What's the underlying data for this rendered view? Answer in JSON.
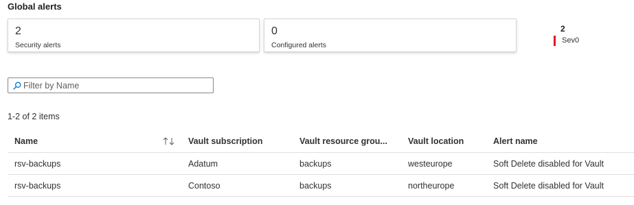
{
  "section_title": "Global alerts",
  "cards": [
    {
      "value": "2",
      "label": "Security alerts"
    },
    {
      "value": "0",
      "label": "Configured alerts"
    }
  ],
  "severity": {
    "count": "2",
    "label": "Sev0",
    "color": "#e81123"
  },
  "filter": {
    "placeholder": "Filter by Name",
    "value": ""
  },
  "items_count": "1-2 of 2 items",
  "table": {
    "columns": {
      "name": "Name",
      "subscription": "Vault subscription",
      "resource_group": "Vault resource grou...",
      "location": "Vault location",
      "alert_name": "Alert name"
    },
    "rows": [
      {
        "name": "rsv-backups",
        "subscription": "Adatum",
        "resource_group": "backups",
        "location": "westeurope",
        "alert_name": "Soft Delete disabled for Vault"
      },
      {
        "name": "rsv-backups",
        "subscription": "Contoso",
        "resource_group": "backups",
        "location": "northeurope",
        "alert_name": "Soft Delete disabled for Vault"
      }
    ]
  },
  "icons": {
    "search": "search-icon",
    "sort": "sort-icon"
  }
}
